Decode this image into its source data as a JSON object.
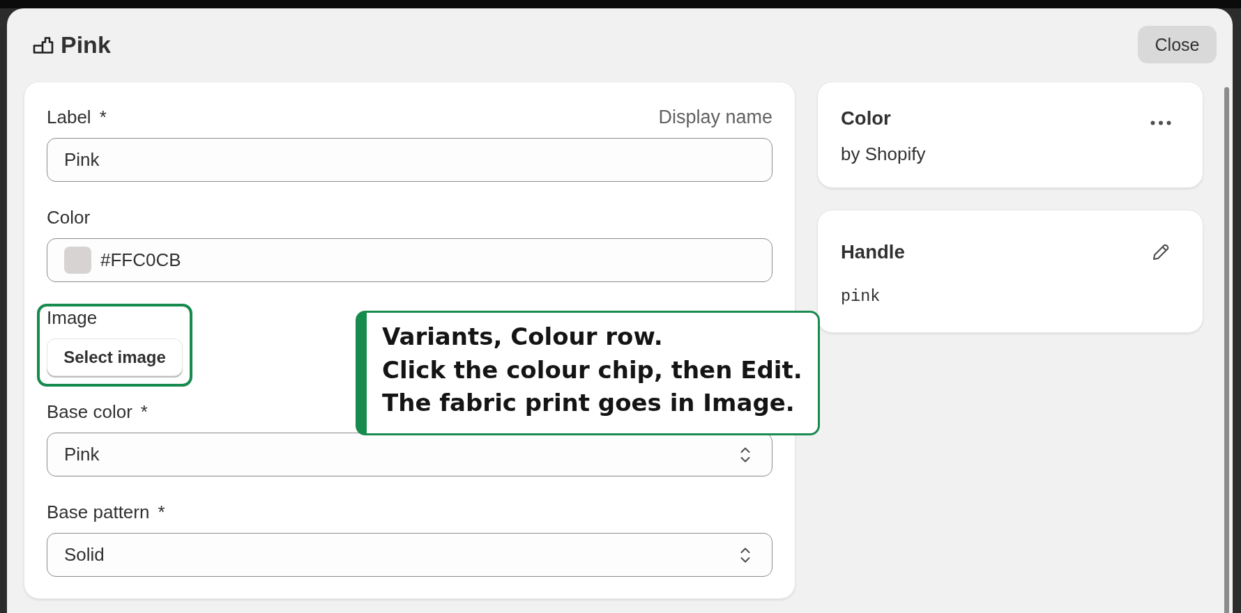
{
  "dialog": {
    "title": "Pink",
    "close_button": "Close"
  },
  "form": {
    "fields": [
      {
        "kind": "text",
        "label": "Label",
        "required_mark": "*",
        "label_note": "Display name",
        "value": "Pink",
        "highlighted": false
      },
      {
        "kind": "color",
        "label": "Color",
        "value": "#FFC0CB",
        "highlighted": false
      },
      {
        "kind": "image",
        "label": "Image",
        "button": "Select image",
        "highlighted": true
      },
      {
        "kind": "select",
        "label": "Base color",
        "required_mark": "*",
        "value": "Pink",
        "highlighted": false
      },
      {
        "kind": "select",
        "label": "Base pattern",
        "required_mark": "*",
        "value": "Solid",
        "highlighted": false
      }
    ]
  },
  "definition_card": {
    "title": "Color",
    "subtitle": "by Shopify"
  },
  "handle_card": {
    "title": "Handle",
    "value": "pink"
  },
  "annotation": {
    "lines": [
      "Variants, Colour row.",
      "Click the colour chip, then Edit.",
      "The fabric print goes in Image."
    ]
  }
}
